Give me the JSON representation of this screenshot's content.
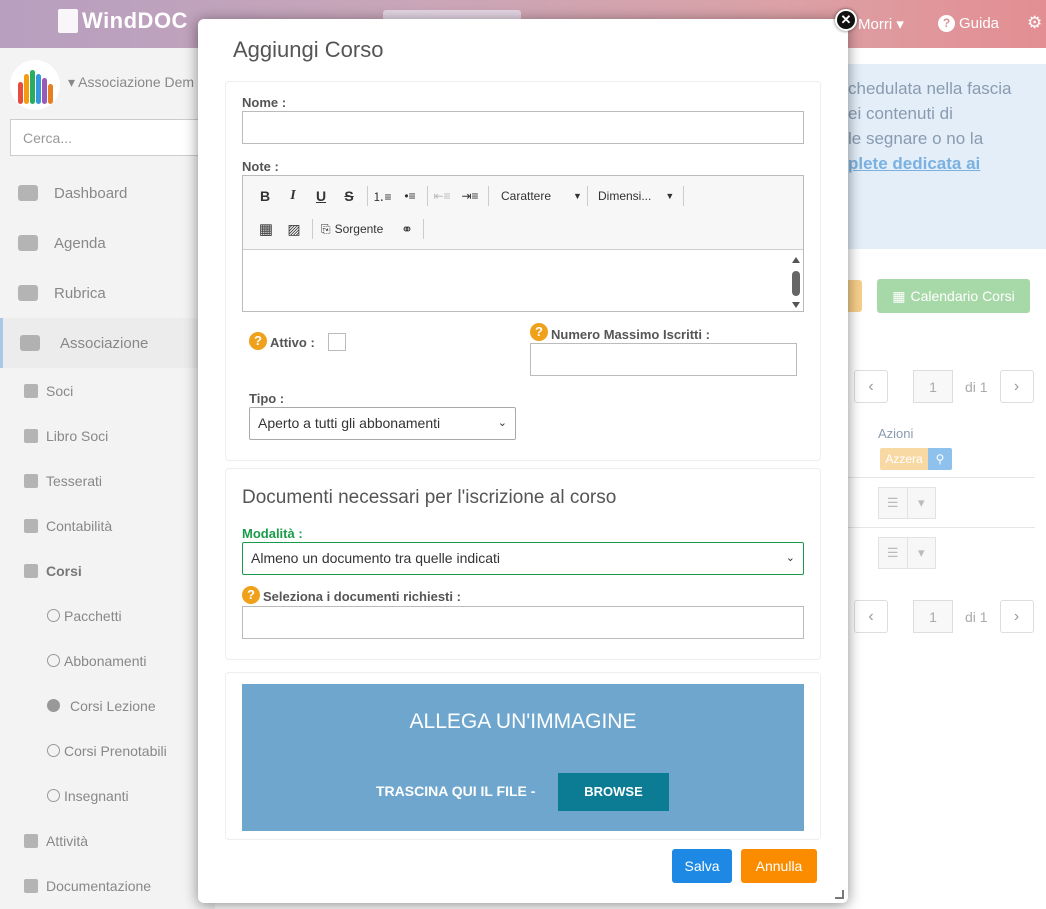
{
  "topbar": {
    "brand": "WindDOC",
    "user_label": "Morri ▾",
    "help_label": "Guida",
    "help_icon": "question-circle-icon",
    "settings_icon": "gear-icon"
  },
  "sidebar": {
    "association_name": "▾ Associazione Dem",
    "search_placeholder": "Cerca...",
    "items": [
      {
        "label": "Dashboard",
        "icon": "dashboard-icon"
      },
      {
        "label": "Agenda",
        "icon": "calendar-icon"
      },
      {
        "label": "Rubrica",
        "icon": "address-book-icon"
      },
      {
        "label": "Associazione",
        "icon": "users-icon"
      }
    ],
    "sub_items": [
      {
        "label": "Soci",
        "icon": "user-icon"
      },
      {
        "label": "Libro Soci",
        "icon": "book-icon"
      },
      {
        "label": "Tesserati",
        "icon": "id-card-icon"
      },
      {
        "label": "Contabilità",
        "icon": "file-icon"
      },
      {
        "label": "Corsi",
        "icon": "graduation-cap-icon"
      }
    ],
    "course_items": [
      {
        "label": "Pacchetti"
      },
      {
        "label": "Abbonamenti"
      },
      {
        "label": "Corsi Lezione"
      },
      {
        "label": "Corsi Prenotabili"
      },
      {
        "label": "Insegnanti"
      }
    ],
    "bottom_items": [
      {
        "label": "Attività",
        "icon": "list-icon"
      },
      {
        "label": "Documentazione",
        "icon": "folder-icon"
      }
    ]
  },
  "background": {
    "info_line1": "chedulata nella fascia",
    "info_line2": "ei contenuti di",
    "info_line3": "le segnare o no la",
    "info_link": "plete dedicata ai",
    "calendar_button": "Calendario Corsi",
    "page_number": "1",
    "page_of": "di 1",
    "actions_header": "Azioni",
    "reset_button": "Azzera"
  },
  "dialog": {
    "title": "Aggiungi Corso",
    "name_label": "Nome :",
    "name_value": "",
    "note_label": "Note :",
    "toolbar": {
      "bold": "B",
      "italic": "I",
      "underline": "U",
      "strike": "S",
      "font_label": "Carattere",
      "size_label": "Dimensi...",
      "source_label": "Sorgente"
    },
    "active_label": "Attivo :",
    "active_checked": false,
    "max_label": "Numero Massimo Iscritti :",
    "max_value": "",
    "type_label": "Tipo :",
    "type_value": "Aperto a tutti gli abbonamenti",
    "docs_title": "Documenti necessari per l'iscrizione al corso",
    "mode_label": "Modalità :",
    "mode_value": "Almeno un documento tra quelle indicati",
    "select_docs_label": "Seleziona i documenti richiesti :",
    "upload_title": "ALLEGA UN'IMMAGINE",
    "upload_drag": "TRASCINA QUI IL FILE -",
    "upload_browse": "BROWSE",
    "save_button": "Salva",
    "cancel_button": "Annulla"
  },
  "colors": {
    "save": "#1e88e5",
    "cancel": "#fb8c00",
    "upload_bg": "#6ea6ce",
    "browse_bg": "#0b7c93",
    "mode_label": "#1a9b4a",
    "help_badge": "#f0a11b"
  }
}
